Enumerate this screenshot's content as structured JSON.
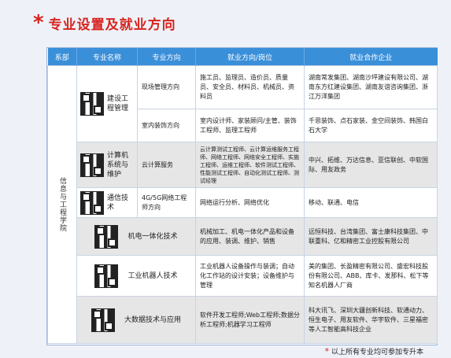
{
  "title": {
    "star": "*",
    "text": "专业设置及就业方向"
  },
  "headers": [
    "系部",
    "专业名称",
    "专业方向",
    "就业方向/岗位",
    "就业合作企业"
  ],
  "department": "信息与工程学院",
  "rows": [
    {
      "major": "建设工程管理",
      "direction": "现场管理方向",
      "jobs": "施工员、监理员、造价员、质量员、安全员、材料员、机械员、资料员",
      "companies": "湖南常发集团、湖南沙坪建设有限公司、湖南东方红建设集团、湖南友谊咨询集团、浙江万洋集团"
    },
    {
      "major": "",
      "direction": "室内装饰方向",
      "jobs": "室内设计师、家装顾问/主管、装饰工程师、监理工程师",
      "companies": "千思装饰、点石家装、金空间装饰、韩国白石大学"
    },
    {
      "major": "计算机系统与维护",
      "direction": "云计算服务",
      "jobs": "云计算测试工程师、云计算运维服务工程师、网络工程师、网络安全工程师、实施工程师、运维工程师、软件测试工程师、性能测试工程师、自动化测试工程师、测试经理",
      "companies": "中兴、拓维、万达信息、亚信联创、中软国际、用友政务"
    },
    {
      "major": "通信技术",
      "direction": "4G/5G网络工程师方向",
      "jobs": "网络运行分析、网络优化",
      "companies": "移动、联通、电信"
    },
    {
      "major": "机电一体化技术",
      "direction": "",
      "jobs": "机械加工、机电一体化产品和设备的应用、装调、维护、销售",
      "companies": "远恒科技、台湾集团、富士康科技集团、中联重科、亿和精密工业控股有限公司"
    },
    {
      "major": "工业机器人技术",
      "direction": "",
      "jobs": "工业机器人设备操作与装调；自动化工作站的设计安装；设备维护与管理",
      "companies": "美的集团、长盈精密有限公司、盛宏科技股份有限公司、ABB、库卡、发那科、松下等知名机器人厂商"
    },
    {
      "major": "大数据技术与应用",
      "direction": "",
      "jobs": "软件开发工程师;Web工程师;数据分析工程师;机器学习工程师",
      "companies": "科大讯飞、深圳大疆创新科技、软通动力、恒生电子、用友软件、华宇软件、三星福密等人工智能高科技企业"
    }
  ],
  "footnote": {
    "star": "*",
    "text": "以上所有专业均可参加专升本"
  }
}
